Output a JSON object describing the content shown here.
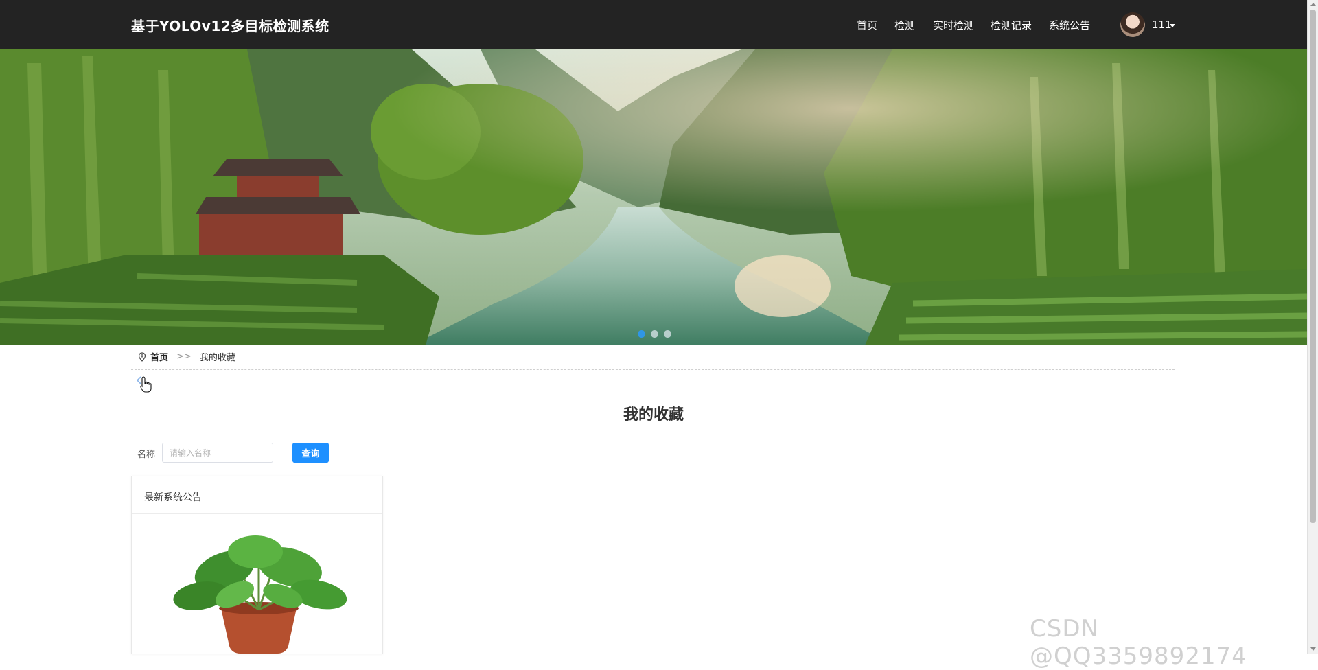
{
  "navbar": {
    "brand": "基于YOLOv12多目标检测系统",
    "items": [
      {
        "label": "首页"
      },
      {
        "label": "检测"
      },
      {
        "label": "实时检测"
      },
      {
        "label": "检测记录"
      },
      {
        "label": "系统公告"
      }
    ],
    "user": {
      "name": "111"
    }
  },
  "banner": {
    "slide_count": 3,
    "active_slide": 1
  },
  "breadcrumb": {
    "home": "首页",
    "separator": ">>",
    "current": "我的收藏"
  },
  "page": {
    "title": "我的收藏"
  },
  "search": {
    "name_label": "名称",
    "name_placeholder": "请输入名称",
    "name_value": "",
    "query_label": "查询"
  },
  "card": {
    "header": "最新系统公告"
  },
  "watermark": "CSDN @QQ3359892174",
  "colors": {
    "navbar_bg": "#232323",
    "accent": "#1e90ff",
    "active_dot": "#2f96e6"
  }
}
